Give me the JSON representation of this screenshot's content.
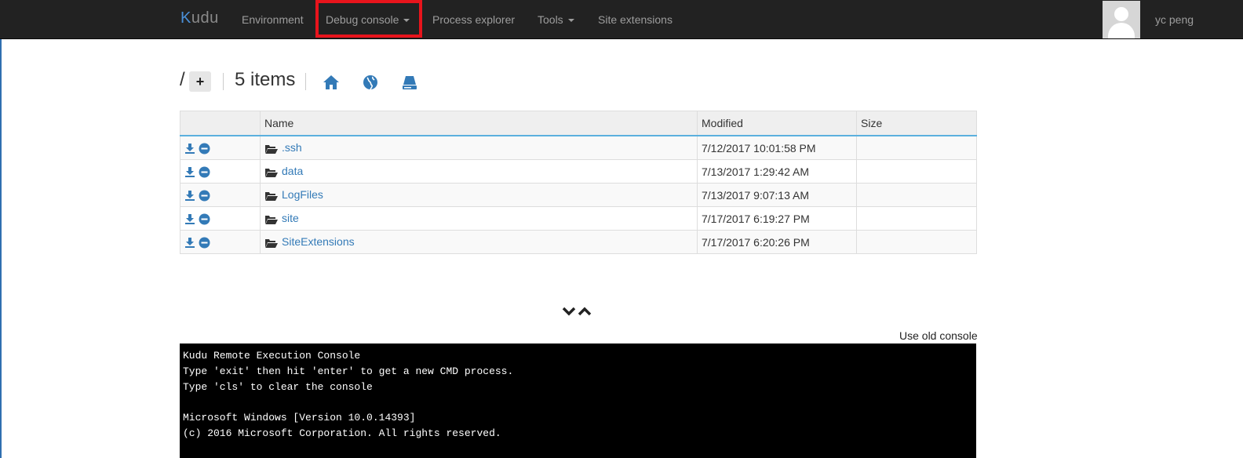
{
  "nav": {
    "brand": "udu",
    "brand_k": "K",
    "items": [
      {
        "label": "Environment",
        "dropdown": false
      },
      {
        "label": "Debug console",
        "dropdown": true,
        "highlighted": true
      },
      {
        "label": "Process explorer",
        "dropdown": false
      },
      {
        "label": "Tools",
        "dropdown": true
      },
      {
        "label": "Site extensions",
        "dropdown": false
      }
    ],
    "user": "yc peng",
    "highlight_color": "#e8141c"
  },
  "browser": {
    "path": "/",
    "items_count": "5 items",
    "icons": [
      "home-icon",
      "globe-icon",
      "drive-icon"
    ]
  },
  "table": {
    "headers": [
      "",
      "Name",
      "Modified",
      "Size"
    ],
    "rows": [
      {
        "name": ".ssh",
        "modified": "7/12/2017 10:01:58 PM",
        "size": ""
      },
      {
        "name": "data",
        "modified": "7/13/2017 1:29:42 AM",
        "size": ""
      },
      {
        "name": "LogFiles",
        "modified": "7/13/2017 9:07:13 AM",
        "size": ""
      },
      {
        "name": "site",
        "modified": "7/17/2017 6:19:27 PM",
        "size": ""
      },
      {
        "name": "SiteExtensions",
        "modified": "7/17/2017 6:20:26 PM",
        "size": ""
      }
    ]
  },
  "console": {
    "old_console_link": "Use old console",
    "lines": [
      "Kudu Remote Execution Console",
      "Type 'exit' then hit 'enter' to get a new CMD process.",
      "Type 'cls' to clear the console",
      "",
      "Microsoft Windows [Version 10.0.14393]",
      "(c) 2016 Microsoft Corporation. All rights reserved."
    ]
  },
  "colors": {
    "navbar": "#222222",
    "link": "#337ab7",
    "icon_blue": "#337ab7",
    "console_bg": "#000000"
  }
}
